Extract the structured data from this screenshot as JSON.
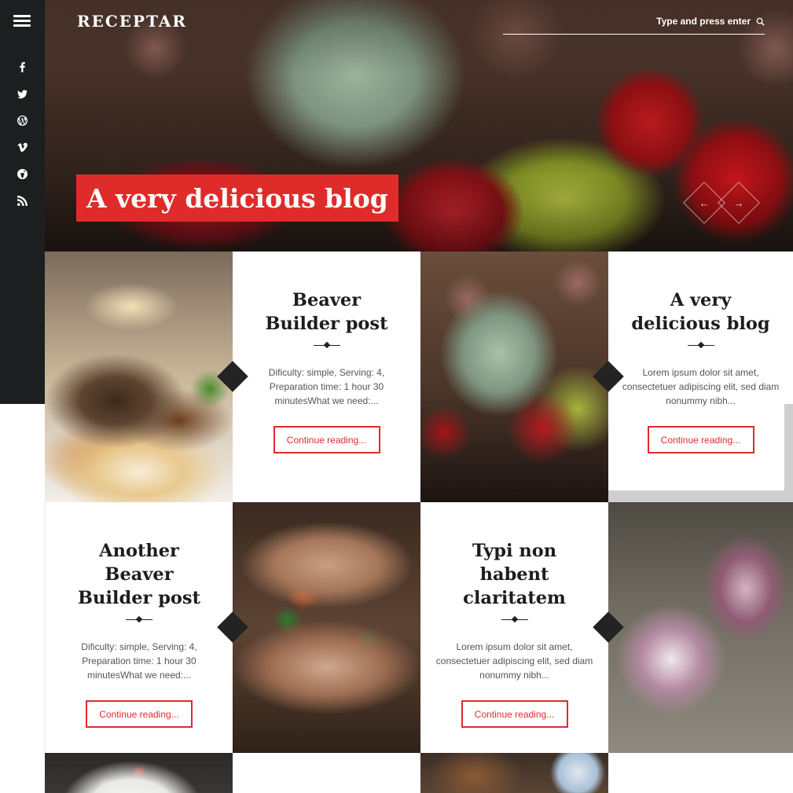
{
  "header": {
    "logo": "RECEPTAR",
    "search_placeholder": "Type and press enter"
  },
  "sidebar": {
    "social": [
      {
        "icon": "facebook-icon"
      },
      {
        "icon": "twitter-icon"
      },
      {
        "icon": "wordpress-icon"
      },
      {
        "icon": "vimeo-icon"
      },
      {
        "icon": "globe-icon"
      },
      {
        "icon": "rss-icon"
      }
    ]
  },
  "hero": {
    "title": "A very delicious blog",
    "prev_label": "←",
    "next_label": "→"
  },
  "posts": [
    {
      "title": "Beaver Builder post",
      "excerpt": "Dificulty: simple, Serving: 4, Preparation time: 1 hour 30 minutesWhat we need:...",
      "button": "Continue reading..."
    },
    {
      "title": "A very delicious blog",
      "excerpt": "Lorem ipsum dolor sit amet, consectetuer adipiscing elit, sed diam nonummy nibh...",
      "button": "Continue reading..."
    },
    {
      "title": "Another Beaver Builder post",
      "excerpt": "Dificulty: simple, Serving: 4, Preparation time: 1 hour 30 minutesWhat we need:...",
      "button": "Continue reading..."
    },
    {
      "title": "Typi non habent claritatem",
      "excerpt": "Lorem ipsum dolor sit amet, consectetuer adipiscing elit, sed diam nonummy nibh...",
      "button": "Continue reading..."
    }
  ],
  "colors": {
    "accent": "#e02b2b",
    "sidebar": "#1c1e20",
    "title_text": "#1d1d1d"
  }
}
